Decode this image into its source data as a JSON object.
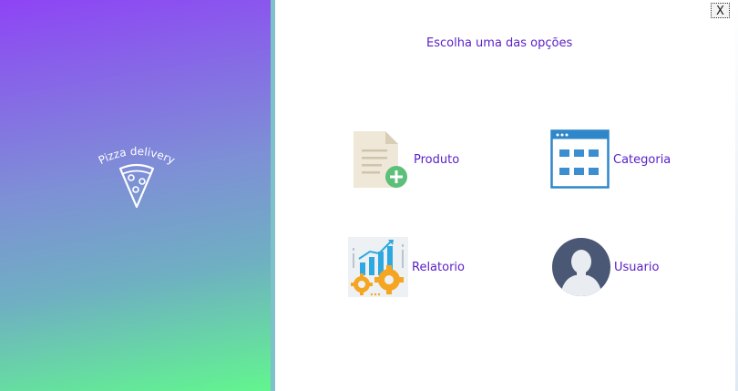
{
  "brand": {
    "logo_text": "Pizza delivery"
  },
  "window": {
    "close_label": "X"
  },
  "main": {
    "title": "Escolha uma das opções",
    "options": [
      {
        "label": "Produto",
        "icon": "document-add-icon"
      },
      {
        "label": "Categoria",
        "icon": "grid-window-icon"
      },
      {
        "label": "Relatorio",
        "icon": "chart-gears-icon"
      },
      {
        "label": "Usuario",
        "icon": "user-avatar-icon"
      }
    ]
  },
  "colors": {
    "accent_text": "#5a20c8",
    "gradient_top": "#8e44f5",
    "gradient_bottom": "#62f58f"
  }
}
